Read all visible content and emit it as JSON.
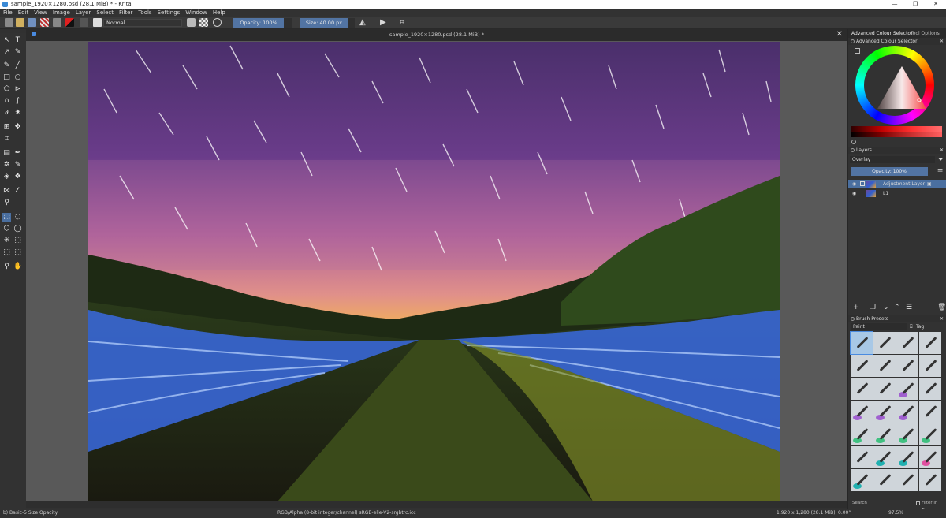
{
  "window": {
    "title": "sample_1920×1280.psd (28.1 MiB) * - Krita",
    "controls": [
      "—",
      "❐",
      "✕"
    ]
  },
  "menu": [
    "File",
    "Edit",
    "View",
    "Image",
    "Layer",
    "Select",
    "Filter",
    "Tools",
    "Settings",
    "Window",
    "Help"
  ],
  "toolbar": {
    "blend_mode": "Normal",
    "opacity": "Opacity: 100%",
    "size": "Size: 40.00 px"
  },
  "document": {
    "tab_title": "sample_1920×1280.psd (28.1 MiB) *",
    "close": "✕"
  },
  "status": {
    "brush": "b) Basic-5 Size Opacity",
    "colorspace": "RGB/Alpha (8-bit integer/channel)  sRGB-elle-V2-srgbtrc.icc",
    "dimensions": "1,920 x 1,280 (28.1 MiB)",
    "rotation": "0.00°",
    "zoom": "97.5%"
  },
  "dock": {
    "tabs": [
      "Advanced Colour Selector",
      "Tool Options"
    ],
    "color_selector_title": "Advanced Colour Selector",
    "layers_title": "Layers",
    "layer_blend": "Overlay",
    "layer_opacity": "Opacity:  100%",
    "layers": [
      {
        "name": "Adjustment Layer",
        "selected": true
      },
      {
        "name": "L1",
        "selected": false
      }
    ],
    "presets_title": "Brush Presets",
    "preset_filter": "Paint",
    "preset_tag": "Tag",
    "search_placeholder": "Search",
    "filter_in_tag": "Filter in Tag"
  },
  "colors": {
    "accent": "#4a6fa0",
    "slider": "#5274a3"
  }
}
